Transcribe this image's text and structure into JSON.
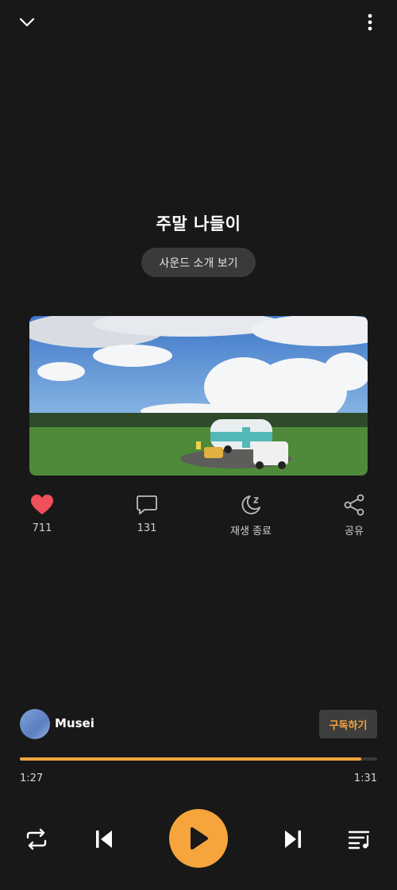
{
  "header": {
    "collapse_icon": "chevron-down-icon",
    "menu_icon": "more-vertical-icon"
  },
  "track": {
    "title": "주말 나들이",
    "intro_button_label": "사운드 소개 보기"
  },
  "actions": [
    {
      "icon": "heart-icon",
      "label": "711",
      "color": "#f0505a"
    },
    {
      "icon": "comment-icon",
      "label": "131"
    },
    {
      "icon": "moon-sleep-icon",
      "label": "재생 종료"
    },
    {
      "icon": "share-icon",
      "label": "공유"
    }
  ],
  "artist": {
    "name": "Musei",
    "subscribe_label": "구독하기"
  },
  "progress": {
    "current": "1:27",
    "total": "1:31",
    "fraction": 0.956
  },
  "controls": {
    "repeat_icon": "repeat-icon",
    "prev_icon": "skip-previous-icon",
    "play_icon": "play-icon",
    "next_icon": "skip-next-icon",
    "queue_icon": "playlist-icon"
  },
  "colors": {
    "accent": "#f5a53c",
    "background": "#181818"
  }
}
